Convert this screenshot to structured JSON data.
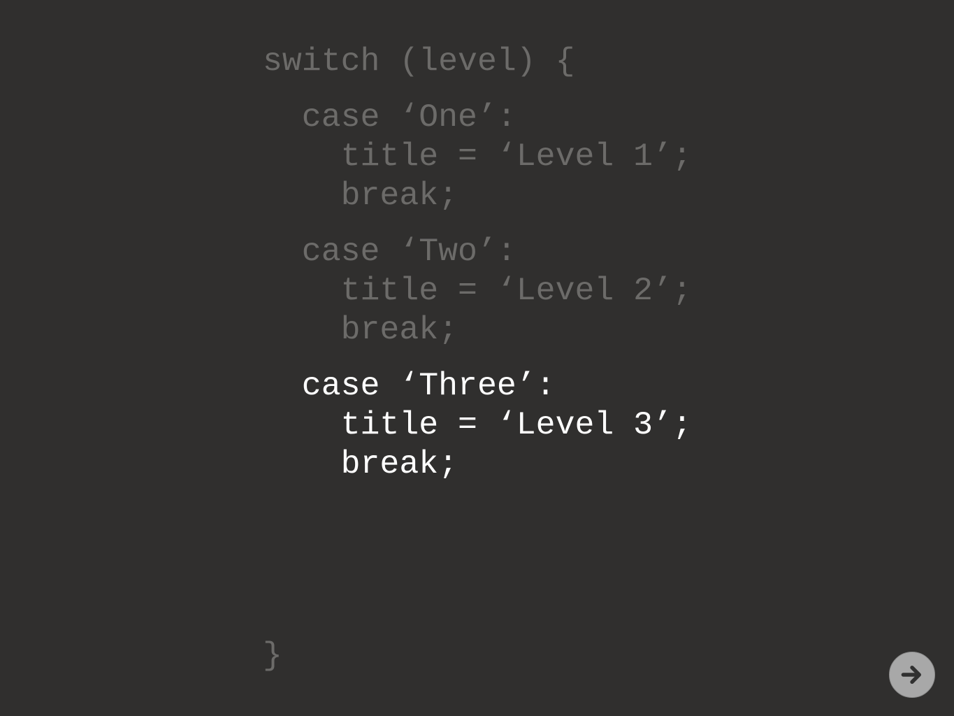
{
  "code": {
    "lines": [
      "switch (level) {",
      "  case ‘One’:",
      "    title = ‘Level 1’;",
      "    break;",
      "  case ‘Two’:",
      "    title = ‘Level 2’;",
      "    break;",
      "  case ‘Three’:",
      "    title = ‘Level 3’;",
      "    break;",
      "}"
    ],
    "dim_color": "#6c6b69",
    "active_color": "#ffffff"
  },
  "navigation": {
    "next_icon": "arrow-right-icon"
  },
  "theme": {
    "background": "#302f2e",
    "button_color": "#a8a8a8"
  }
}
